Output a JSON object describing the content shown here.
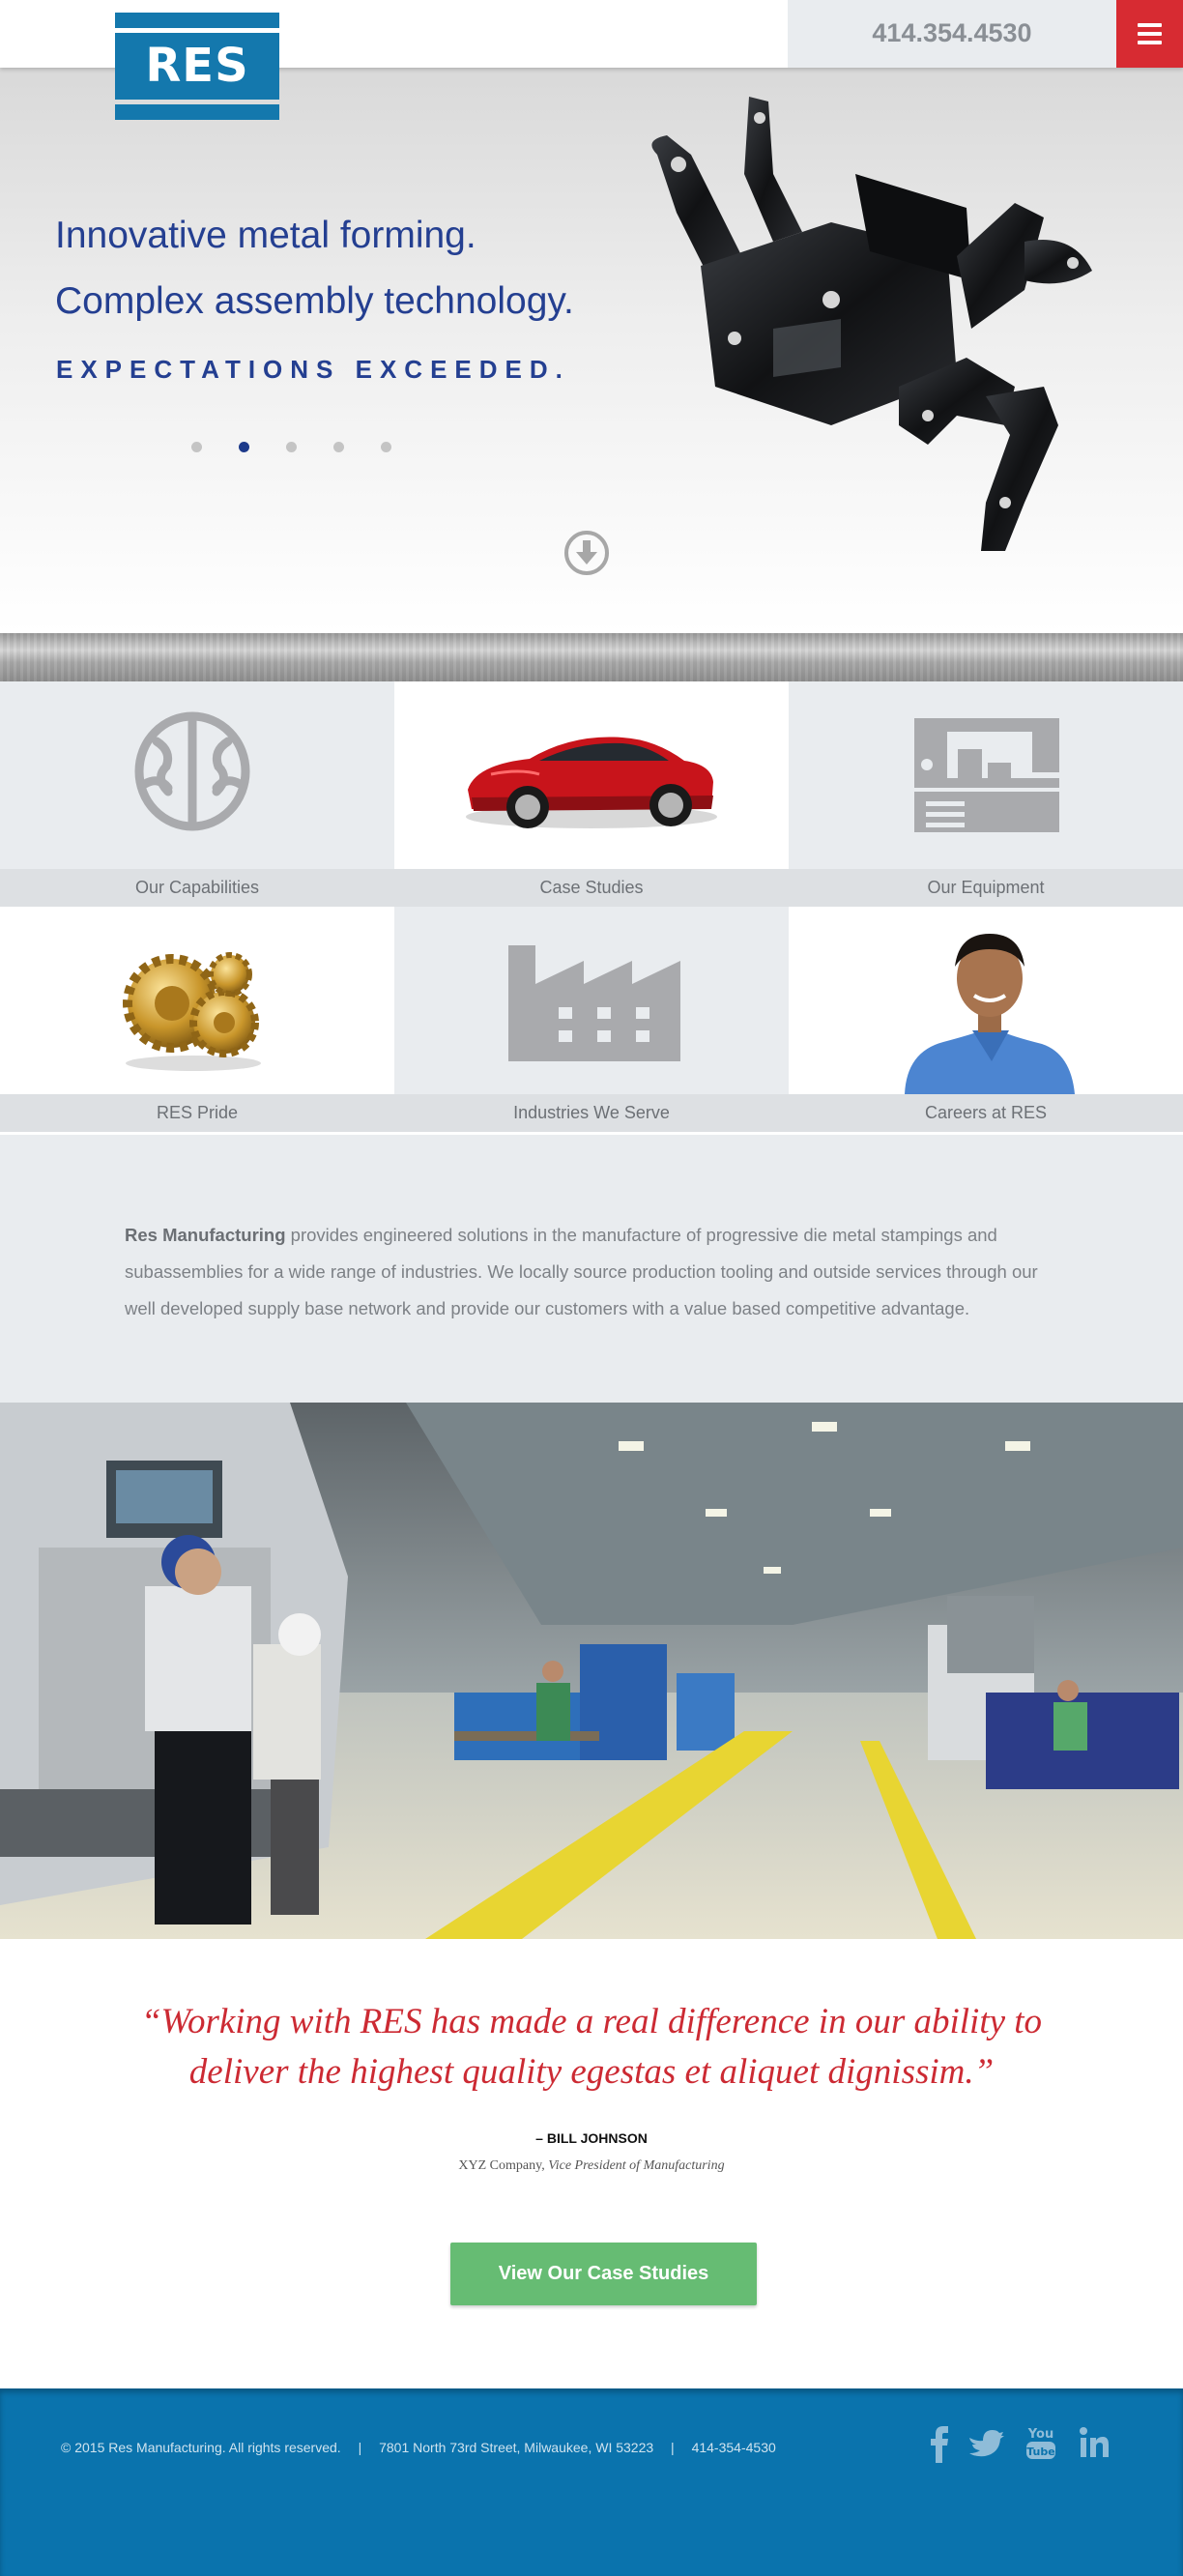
{
  "header": {
    "logo_text": "RES",
    "phone": "414.354.4530",
    "menu_icon": "hamburger-icon"
  },
  "hero": {
    "line1": "Innovative metal forming.",
    "line2": "Complex assembly technology.",
    "tagline": "EXPECTATIONS EXCEEDED.",
    "slides": {
      "count": 5,
      "active": 2
    },
    "scroll_icon": "arrow-down-circle-icon"
  },
  "tiles": [
    {
      "label": "Our Capabilities",
      "icon": "brain-icon"
    },
    {
      "label": "Case Studies",
      "icon": "red-car-image"
    },
    {
      "label": "Our Equipment",
      "icon": "machine-icon"
    },
    {
      "label": "RES Pride",
      "icon": "gold-gears-image"
    },
    {
      "label": "Industries We Serve",
      "icon": "factory-icon"
    },
    {
      "label": "Careers at RES",
      "icon": "employee-photo"
    }
  ],
  "about": {
    "company": "Res Manufacturing",
    "text": " provides engineered solutions in the manufacture of progressive die metal stampings and subassemblies for a wide range of industries. We locally source production tooling and outside services through our well developed supply base network and provide our customers with a value based competitive advantage."
  },
  "testimonial": {
    "quote": "“Working with RES has made a real difference in our ability to deliver the highest quality egestas et aliquet dignissim.”",
    "author": "– BILL JOHNSON",
    "company": "XYZ Company,",
    "title": "Vice President of Manufacturing"
  },
  "cta": {
    "label": "View Our Case Studies"
  },
  "footer": {
    "copyright": "© 2015 Res Manufacturing. All rights reserved.",
    "address": "7801 North 73rd Street, Milwaukee, WI 53223",
    "phone": "414-354-4530",
    "separator": "|",
    "social": [
      "facebook-icon",
      "twitter-icon",
      "youtube-icon",
      "linkedin-icon"
    ]
  },
  "colors": {
    "brand_blue": "#1478ad",
    "headline_blue": "#243f91",
    "accent_red": "#d72b32",
    "cta_green": "#66bc73",
    "footer_blue": "#0a73ad"
  }
}
